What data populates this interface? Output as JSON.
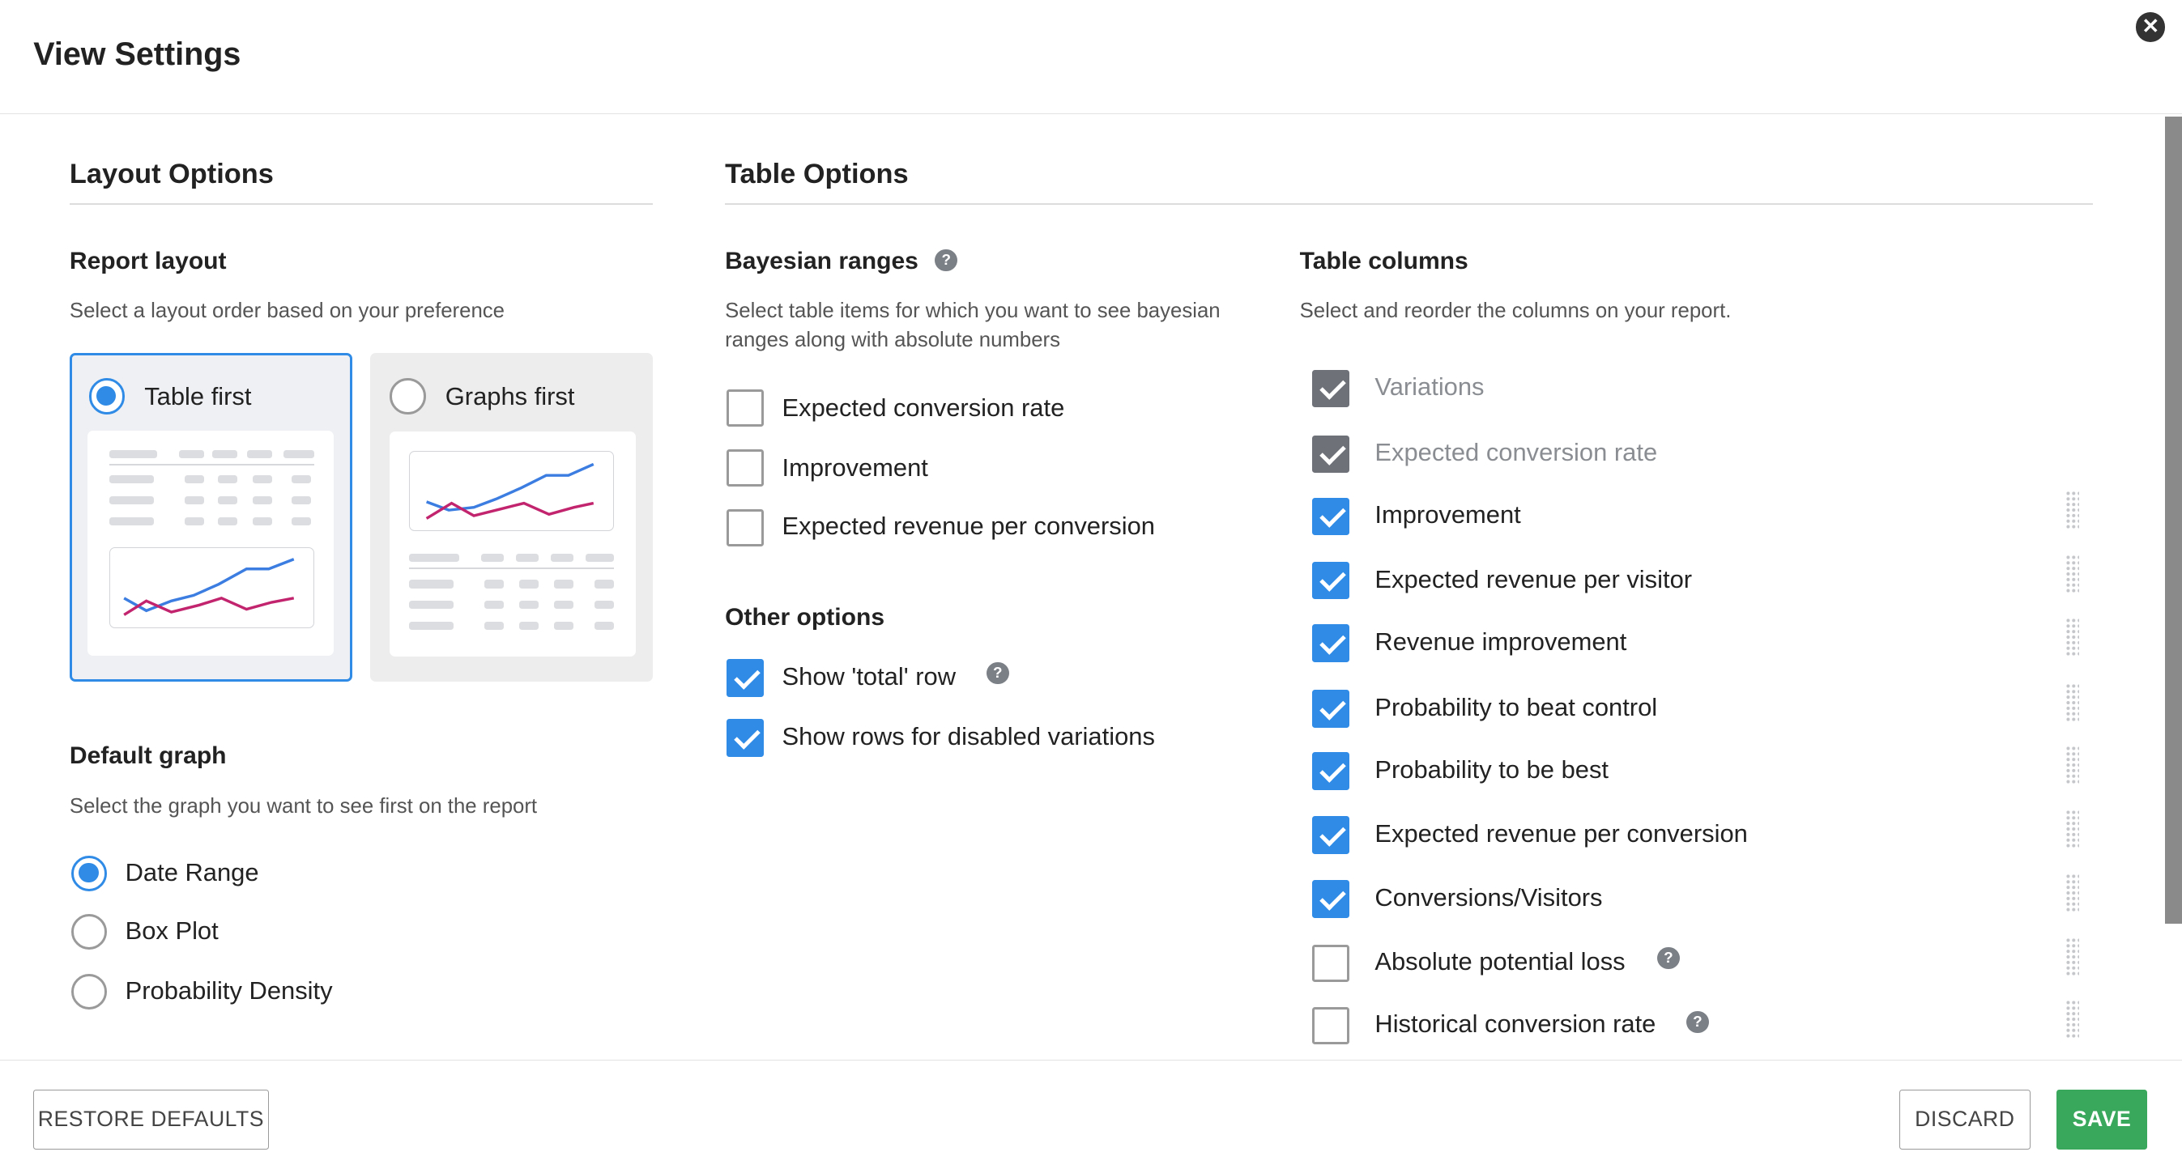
{
  "dialog": {
    "title": "View Settings"
  },
  "layout_options": {
    "title": "Layout Options",
    "report_layout": {
      "title": "Report layout",
      "description": "Select a layout order based on your preference",
      "options": [
        {
          "label": "Table first",
          "selected": true
        },
        {
          "label": "Graphs first",
          "selected": false
        }
      ]
    },
    "default_graph": {
      "title": "Default graph",
      "description": "Select the graph you want to see first on the report",
      "options": [
        {
          "label": "Date Range",
          "selected": true
        },
        {
          "label": "Box Plot",
          "selected": false
        },
        {
          "label": "Probability Density",
          "selected": false
        }
      ]
    }
  },
  "table_options": {
    "title": "Table Options",
    "bayesian_ranges": {
      "title": "Bayesian ranges",
      "description_line1": "Select table items for which you want to see bayesian",
      "description_line2": "ranges along with absolute numbers",
      "items": [
        {
          "label": "Expected conversion rate",
          "checked": false
        },
        {
          "label": "Improvement",
          "checked": false
        },
        {
          "label": "Expected revenue per conversion",
          "checked": false
        }
      ]
    },
    "other_options": {
      "title": "Other options",
      "items": [
        {
          "label": "Show 'total' row",
          "checked": true,
          "help": true
        },
        {
          "label": "Show rows for disabled variations",
          "checked": true
        }
      ]
    },
    "table_columns": {
      "title": "Table columns",
      "description": "Select and reorder the columns on your report.",
      "items": [
        {
          "label": "Variations",
          "checked": true,
          "locked": true
        },
        {
          "label": "Expected conversion rate",
          "checked": true,
          "locked": true
        },
        {
          "label": "Improvement",
          "checked": true
        },
        {
          "label": "Expected revenue per visitor",
          "checked": true
        },
        {
          "label": "Revenue improvement",
          "checked": true
        },
        {
          "label": "Probability to beat control",
          "checked": true
        },
        {
          "label": "Probability to be best",
          "checked": true
        },
        {
          "label": "Expected revenue per conversion",
          "checked": true
        },
        {
          "label": "Conversions/Visitors",
          "checked": true
        },
        {
          "label": "Absolute potential loss",
          "checked": false,
          "help": true
        },
        {
          "label": "Historical conversion rate",
          "checked": false,
          "help": true
        }
      ]
    }
  },
  "footer": {
    "restore_label": "RESTORE DEFAULTS",
    "discard_label": "DISCARD",
    "save_label": "SAVE"
  },
  "icons": {
    "close": "close-circle-icon",
    "help": "question-circle-icon",
    "drag": "drag-handle-icon"
  },
  "colors": {
    "accent": "#2f8be6",
    "save": "#3aa85c",
    "chart_blue": "#3b7de0",
    "chart_pink": "#c2256e"
  }
}
